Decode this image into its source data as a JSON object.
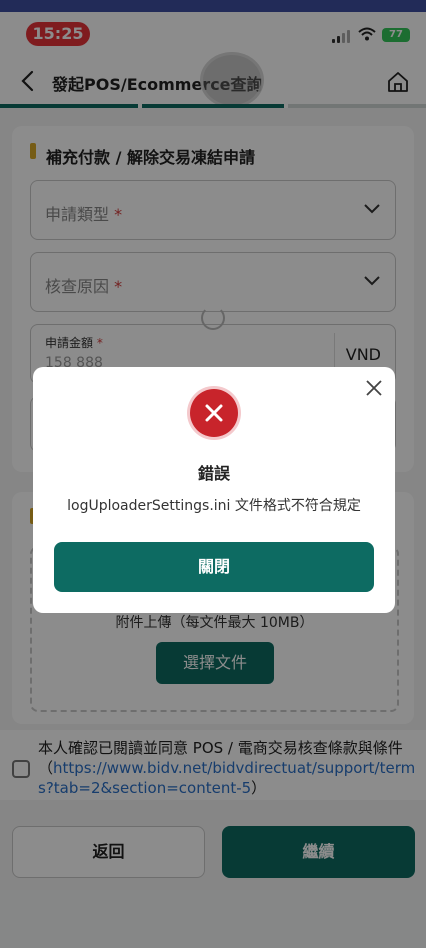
{
  "status": {
    "time": "15:25",
    "battery": "77"
  },
  "header": {
    "title": "發起POS/Ecommerce查詢"
  },
  "form": {
    "section_title": "補充付款 / 解除交易凍結申請",
    "request_type_label": "申請類型",
    "reason_label": "核查原因",
    "amount_label": "申請金額",
    "amount_value": "158 888",
    "currency": "VND",
    "required_mark": "*"
  },
  "upload": {
    "hint": "附件上傳（每文件最大 10MB）",
    "choose_button": "選擇文件"
  },
  "terms": {
    "text": "本人確認已閱讀並同意 POS / 電商交易核查條款與條件（",
    "link": "https://www.bidv.net/bidvdirectuat/support/terms?tab=2&section=content-5",
    "close_paren": "）"
  },
  "buttons": {
    "back": "返回",
    "continue": "繼續"
  },
  "dialog": {
    "title": "錯誤",
    "message": "logUploaderSettings.ini 文件格式不符合規定",
    "close_button": "關閉"
  },
  "colors": {
    "primary": "#0d6b62",
    "error": "#c8242b",
    "accent": "#d8a827",
    "link": "#2a6fc6"
  }
}
